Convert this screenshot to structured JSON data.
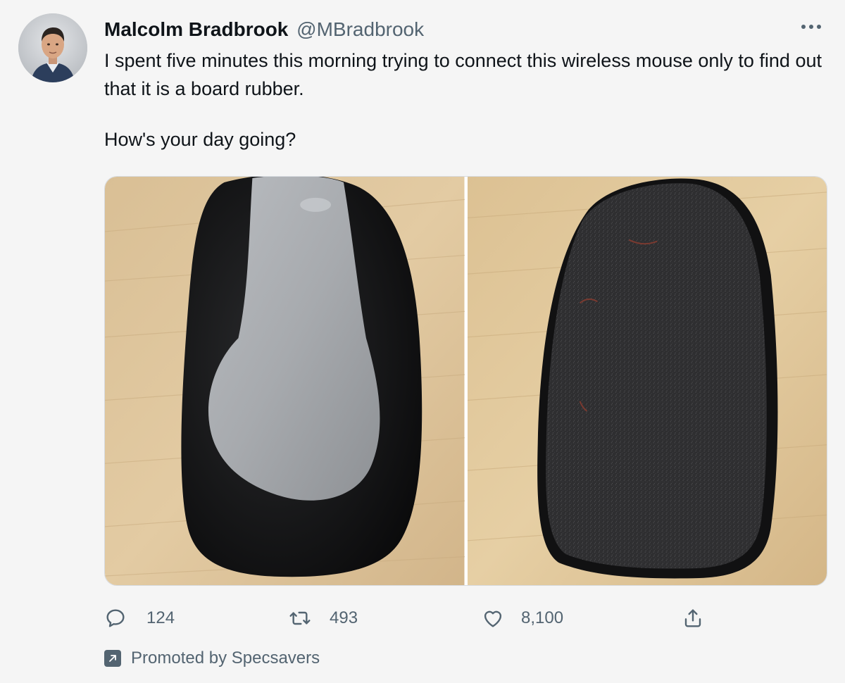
{
  "tweet": {
    "author": {
      "display_name": "Malcolm Bradbrook",
      "handle": "@MBradbrook",
      "avatar_icon": "avatar-photo"
    },
    "text_line1": "I spent five minutes this morning trying to connect this wireless mouse only to find out that it is a board rubber.",
    "text_line2": "How's your day going?",
    "media": [
      {
        "icon": "mouse-top-photo"
      },
      {
        "icon": "felt-eraser-photo"
      }
    ],
    "actions": {
      "reply": {
        "icon": "reply-bubble-icon",
        "count": "124"
      },
      "retweet": {
        "icon": "retweet-arrows-icon",
        "count": "493"
      },
      "like": {
        "icon": "heart-icon",
        "count": "8,100"
      },
      "share": {
        "icon": "share-upload-icon"
      }
    },
    "promoted": {
      "icon": "promoted-arrow-icon",
      "text": "Promoted by Specsavers"
    },
    "more_icon": "more-dots-icon"
  },
  "colors": {
    "text_primary": "#0f1419",
    "text_secondary": "#536471",
    "background": "#f5f5f5"
  }
}
